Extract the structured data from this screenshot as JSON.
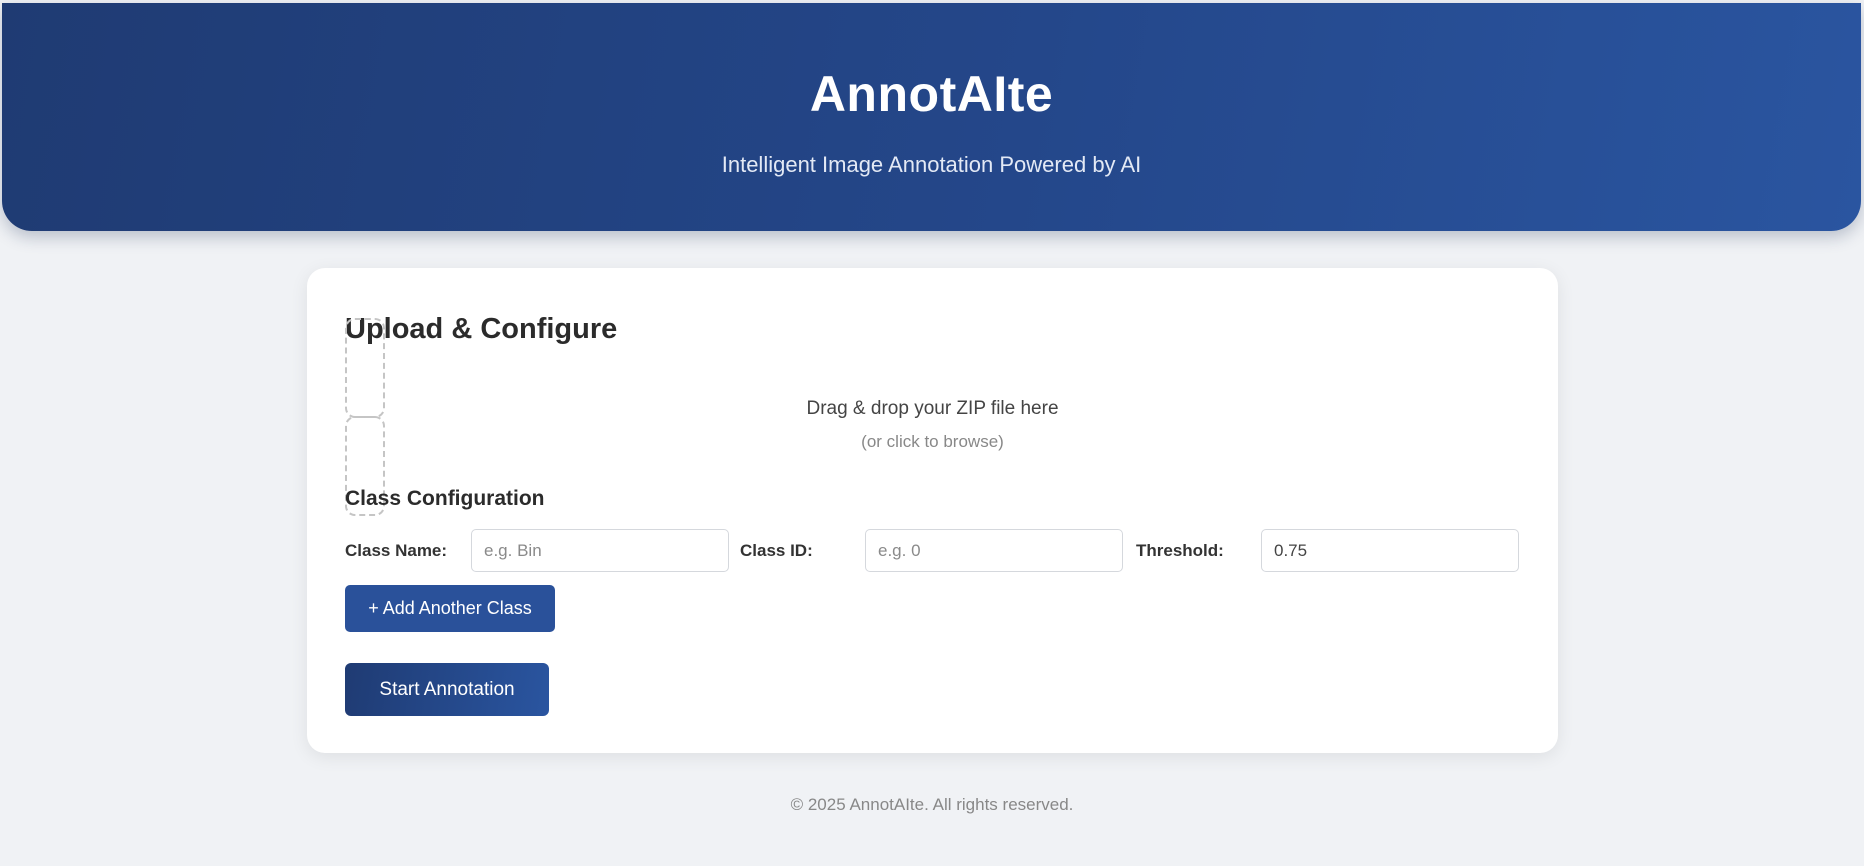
{
  "header": {
    "title": "AnnotAIte",
    "subtitle": "Intelligent Image Annotation Powered by AI"
  },
  "card": {
    "title": "Upload & Configure",
    "dropzone": {
      "main_text": "Drag & drop your ZIP file here",
      "sub_text": "(or click to browse)"
    },
    "class_config": {
      "title": "Class Configuration",
      "class_name_label": "Class Name:",
      "class_name_placeholder": "e.g. Bin",
      "class_id_label": "Class ID:",
      "class_id_placeholder": "e.g. 0",
      "threshold_label": "Threshold:",
      "threshold_value": "0.75"
    },
    "add_class_label": "+ Add Another Class",
    "start_label": "Start Annotation"
  },
  "footer": {
    "text": "© 2025 AnnotAIte. All rights reserved."
  },
  "colors": {
    "header_start": "#1f3b73",
    "header_end": "#2a55a0",
    "button": "#2a519a",
    "background": "#f0f2f5"
  }
}
